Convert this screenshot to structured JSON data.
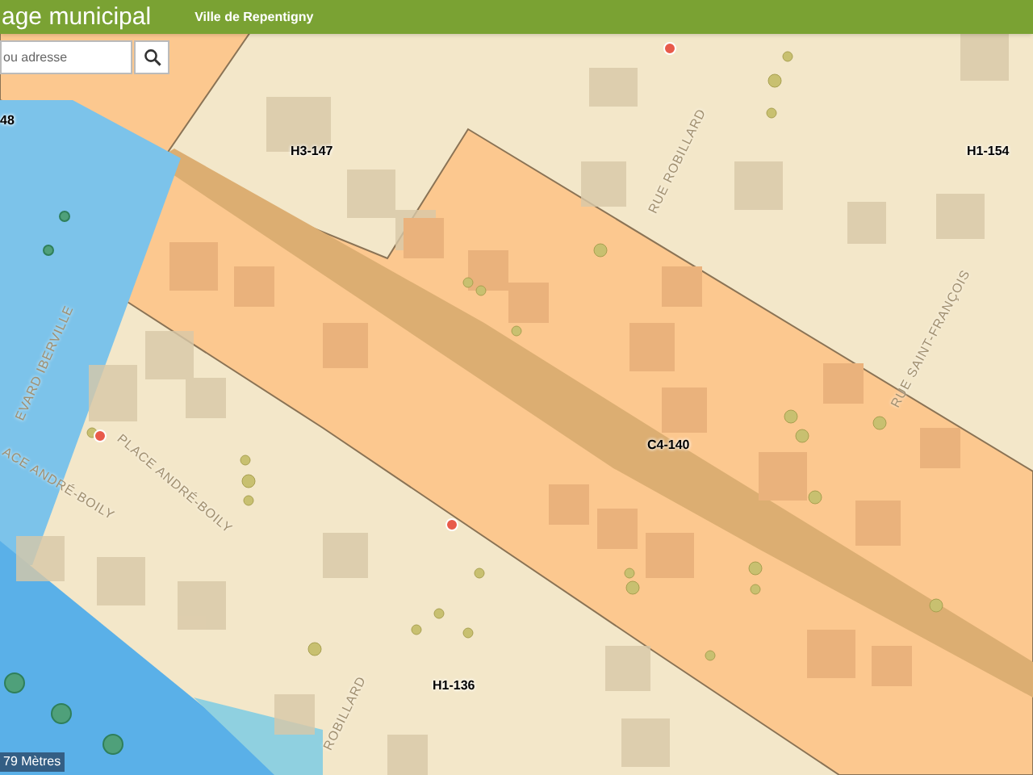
{
  "header": {
    "title": "age municipal",
    "subtitle": "Ville de Repentigny"
  },
  "search": {
    "placeholder": "ou adresse"
  },
  "map": {
    "zones": [
      {
        "label": "48"
      },
      {
        "label": "H3-147"
      },
      {
        "label": "H1-154"
      },
      {
        "label": "C4-140"
      },
      {
        "label": "H1-136"
      }
    ],
    "streets": [
      {
        "label": "RUE ROBILLARD"
      },
      {
        "label": "ROBILLARD"
      },
      {
        "label": "RUE SAINT-FRANÇOIS"
      },
      {
        "label": "EVARD IBERVILLE"
      },
      {
        "label": "ACE ANDRÉ-BOILY"
      },
      {
        "label": "PLACE ANDRÉ-BOILY"
      }
    ],
    "scale": "79 Mètres"
  }
}
